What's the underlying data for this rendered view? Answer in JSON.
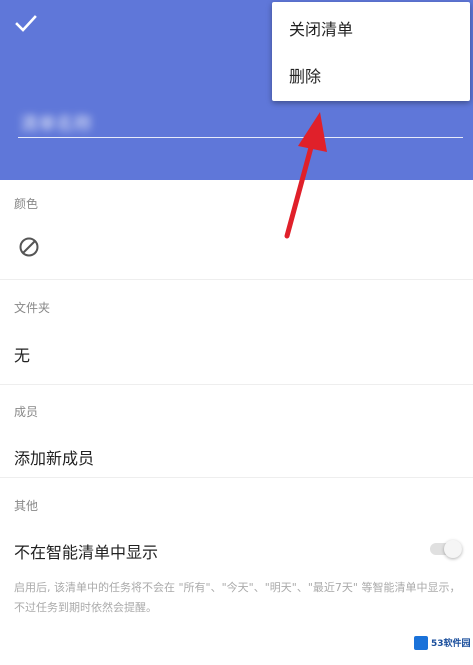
{
  "header": {
    "list_name": "清单名称",
    "background_color": "#5f77d9"
  },
  "popup_menu": {
    "items": [
      {
        "label": "关闭清单"
      },
      {
        "label": "删除"
      }
    ]
  },
  "sections": {
    "color": {
      "label": "颜色",
      "icon": "no-color-icon"
    },
    "folder": {
      "label": "文件夹",
      "value": "无"
    },
    "members": {
      "label": "成员",
      "value": "添加新成员"
    },
    "other": {
      "label": "其他",
      "toggle_label": "不在智能清单中显示",
      "toggle_on": false,
      "description": "启用后, 该清单中的任务将不会在 \"所有\"、\"今天\"、\"明天\"、\"最近7天\" 等智能清单中显示，不过任务到期时依然会提醒。"
    }
  },
  "watermark": {
    "text": "53软件园"
  },
  "annotation": {
    "arrow_color": "#e0202a"
  }
}
